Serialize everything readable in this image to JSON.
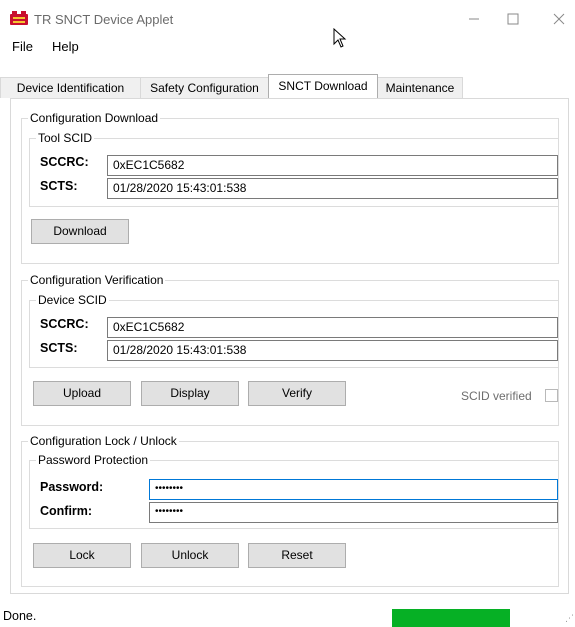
{
  "window": {
    "title": "TR SNCT Device Applet"
  },
  "menu": {
    "file": "File",
    "help": "Help"
  },
  "tabs": [
    {
      "label": "Device Identification"
    },
    {
      "label": "Safety Configuration"
    },
    {
      "label": "SNCT Download"
    },
    {
      "label": "Maintenance"
    }
  ],
  "active_tab": "SNCT Download",
  "download": {
    "group": "Configuration Download",
    "sub": "Tool SCID",
    "sccrc_label": "SCCRC:",
    "sccrc": "0xEC1C5682",
    "scts_label": "SCTS:",
    "scts": "01/28/2020 15:43:01:538",
    "btn": "Download"
  },
  "verify": {
    "group": "Configuration Verification",
    "sub": "Device SCID",
    "sccrc_label": "SCCRC:",
    "sccrc": "0xEC1C5682",
    "scts_label": "SCTS:",
    "scts": "01/28/2020 15:43:01:538",
    "btn_upload": "Upload",
    "btn_display": "Display",
    "btn_verify": "Verify",
    "scid_verified_label": "SCID verified",
    "scid_verified": false
  },
  "lock": {
    "group": "Configuration Lock / Unlock",
    "sub": "Password Protection",
    "password_label": "Password:",
    "password": "••••••••",
    "confirm_label": "Confirm:",
    "confirm": "••••••••",
    "btn_lock": "Lock",
    "btn_unlock": "Unlock",
    "btn_reset": "Reset"
  },
  "status": {
    "text": "Done.",
    "progress_percent": 100
  },
  "colors": {
    "progress": "#06b025",
    "focus": "#0078d7"
  }
}
